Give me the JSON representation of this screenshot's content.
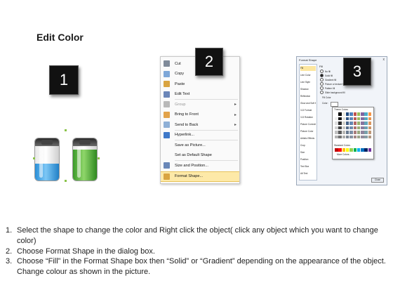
{
  "header": {
    "title": "Edit Color"
  },
  "step_badges": [
    "1",
    "2",
    "3"
  ],
  "context_menu": {
    "items": [
      {
        "label": "Cut",
        "icon": "scissors-icon",
        "color": "#7f8a99"
      },
      {
        "label": "Copy",
        "icon": "copy-icon",
        "color": "#7ea7d8"
      },
      {
        "label": "Paste",
        "icon": "paste-icon",
        "color": "#d9a441"
      },
      {
        "label": "Edit Text",
        "icon": "edit-text-icon",
        "color": "#6b86b8"
      },
      {
        "label": "Group",
        "icon": "group-icon",
        "color": "#b9b9b9",
        "disabled": true,
        "submenu": true
      },
      {
        "label": "Bring to Front",
        "icon": "bring-to-front-icon",
        "color": "#e2a34a",
        "submenu": true
      },
      {
        "label": "Send to Back",
        "icon": "send-to-back-icon",
        "color": "#8fb0d6",
        "submenu": true
      },
      {
        "label": "Hyperlink...",
        "icon": "hyperlink-icon",
        "color": "#3f79c9"
      },
      {
        "label": "Save as Picture...",
        "icon": "",
        "color": ""
      },
      {
        "label": "Set as Default Shape",
        "icon": "",
        "color": ""
      },
      {
        "label": "Size and Position...",
        "icon": "size-position-icon",
        "color": "#6a88b8"
      },
      {
        "label": "Format Shape...",
        "icon": "format-shape-icon",
        "color": "#d9a441",
        "highlighted": true
      }
    ]
  },
  "format_dialog": {
    "title": "Format Shape",
    "close": "x",
    "categories": [
      "Fill",
      "Line Color",
      "Line Style",
      "Shadow",
      "Reflection",
      "Glow and Soft Edges",
      "3-D Format",
      "3-D Rotation",
      "Picture Corrections",
      "Picture Color",
      "Artistic Effects",
      "Crop",
      "Size",
      "Position",
      "Text Box",
      "Alt Text"
    ],
    "section_label": "Fill",
    "options": [
      "No fill",
      "Solid fill",
      "Gradient fill",
      "Picture or texture fill",
      "Pattern fill",
      "Slide background fill"
    ],
    "subsection_label": "Fill Color",
    "color_label": "Color:",
    "palette_theme_label": "Theme Colors",
    "palette_standard_label": "Standard Colors",
    "palette_more_label": "More Colors...",
    "close_button": "Close",
    "theme_colors": [
      "#ffffff",
      "#000000",
      "#eeece1",
      "#1f497d",
      "#4f81bd",
      "#c0504d",
      "#9bbb59",
      "#8064a2",
      "#4bacc6",
      "#f79646"
    ],
    "standard_colors": [
      "#c00000",
      "#ff0000",
      "#ffc000",
      "#ffff00",
      "#92d050",
      "#00b050",
      "#00b0f0",
      "#0070c0",
      "#002060",
      "#7030a0"
    ]
  },
  "batteries": [
    {
      "name": "blue battery",
      "color": "#2a8fd8",
      "level": 0.4
    },
    {
      "name": "green battery",
      "color": "#3b9a2a",
      "level": 0.73
    }
  ],
  "instructions": [
    {
      "number": "1.",
      "text": "Select the shape to change the color and Right click the object( click any object which you want to change color)"
    },
    {
      "number": "2.",
      "text": "Choose Format Shape in the dialog box."
    },
    {
      "number": "3.",
      "text": "Choose “Fill” in the Format Shape box then “Solid” or “Gradient” depending on the appearance of the object. Change colour as shown in the picture."
    }
  ]
}
